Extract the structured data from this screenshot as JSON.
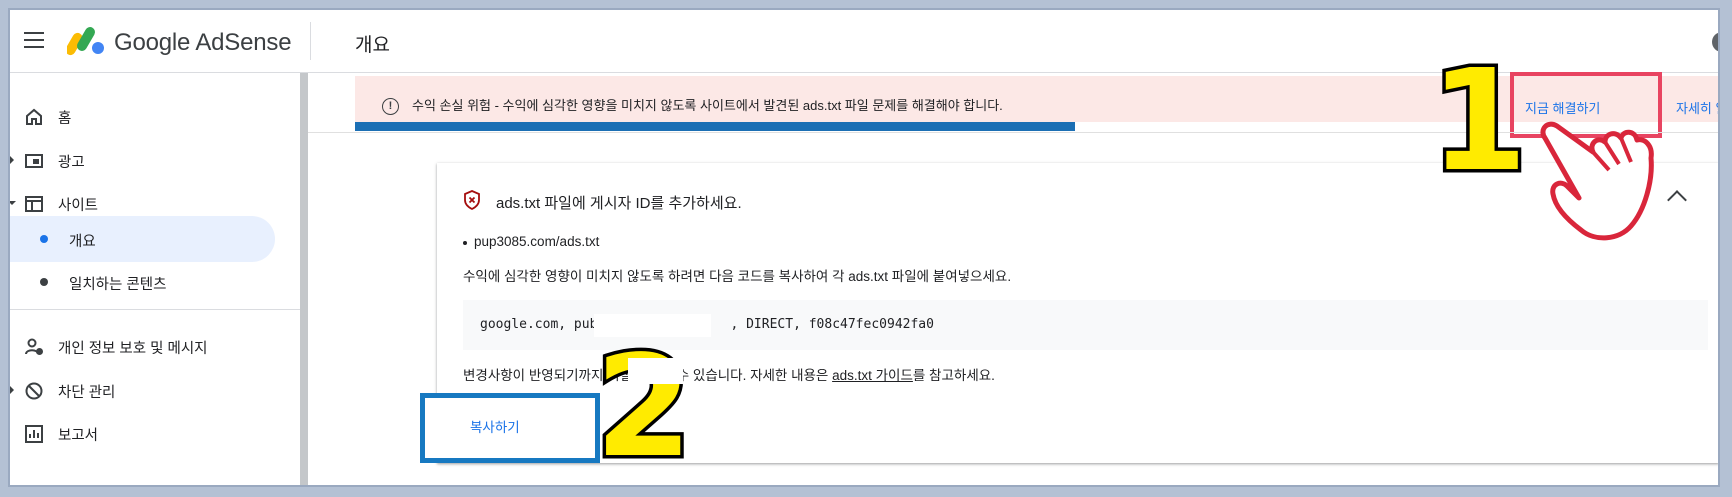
{
  "app": {
    "product_name": "Google AdSense",
    "page_title": "개요"
  },
  "sidebar": {
    "items": [
      {
        "label": "홈",
        "icon": "home-icon"
      },
      {
        "label": "광고",
        "icon": "ads-icon"
      },
      {
        "label": "사이트",
        "icon": "sites-icon"
      },
      {
        "label": "개요",
        "icon": "dot",
        "active": true
      },
      {
        "label": "일치하는 콘텐츠",
        "icon": "dot"
      },
      {
        "label": "개인 정보 보호 및 메시지",
        "icon": "privacy-icon"
      },
      {
        "label": "차단 관리",
        "icon": "block-icon"
      },
      {
        "label": "보고서",
        "icon": "reports-icon"
      }
    ]
  },
  "alert": {
    "text": "수익 손실 위험 - 수익에 심각한 영향을 미치지 않도록 사이트에서 발견된 ads.txt 파일 문제를 해결해야 합니다.",
    "fix_now": "지금 해결하기",
    "details": "자세히 알"
  },
  "card": {
    "title": "ads.txt 파일에 게시자 ID를 추가하세요.",
    "site": "pup3085.com/ads.txt",
    "instruction": "수익에 심각한 영향이 미치지 않도록 하려면 다음 코드를 복사하여 각 ads.txt 파일에 붙여넣으세요.",
    "code": "google.com, pub-                , DIRECT, f08c47fec0942fa0",
    "note_before": "변경사항이 반영되기까지 며칠이 걸릴 수 있습니다. 자세한 내용은 ",
    "note_link": "ads.txt 가이드",
    "note_after": "를 참고하세요.",
    "copy_button": "복사하기"
  },
  "annotations": {
    "step1": "1",
    "step2": "2"
  },
  "colors": {
    "accent": "#1a73e8",
    "alert_bg": "#fce8e6",
    "highlight_red": "#e84461",
    "highlight_blue": "#1779c1",
    "annotation_yellow": "#ffeb00"
  }
}
